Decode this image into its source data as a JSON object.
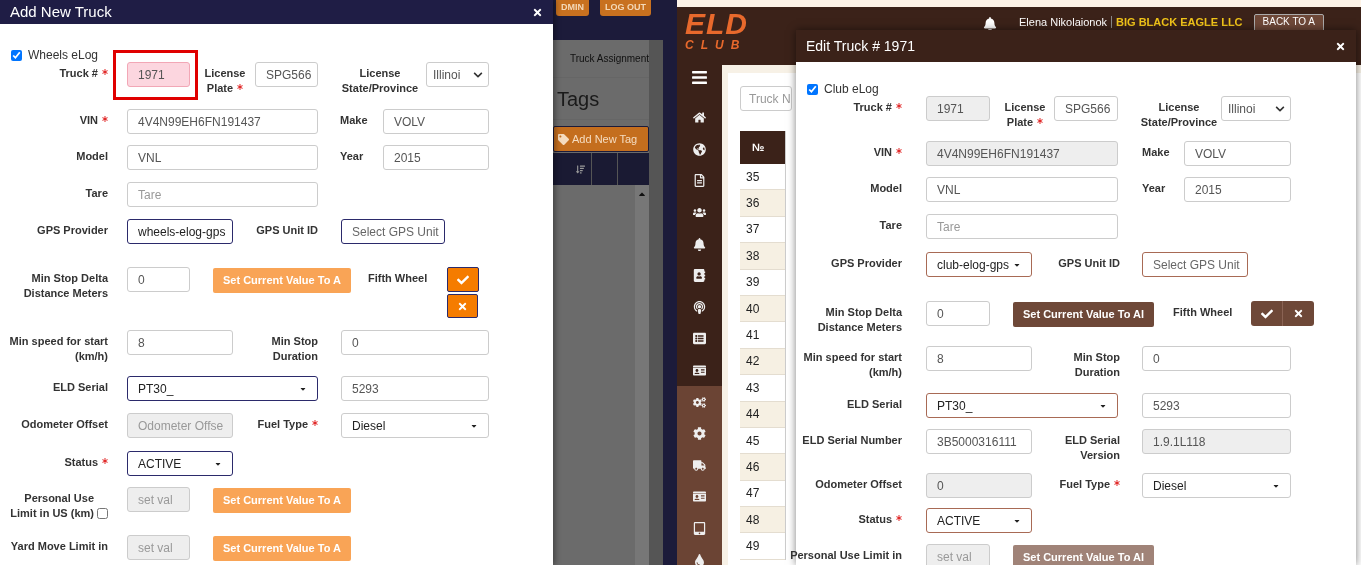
{
  "wheels_screen": {
    "topbar_buttons": [
      "DMIN",
      "LOG OUT"
    ],
    "tab": "Truck Assignment",
    "heading": "Tags",
    "add_button": "Add New Tag",
    "modal": {
      "kind": "wheels",
      "title": "Add New Truck",
      "checkbox": {
        "label": "Wheels eLog",
        "checked": true
      },
      "rows": [
        {
          "fields": [
            {
              "kind": "label",
              "text": "Truck #",
              "required": true
            },
            {
              "kind": "input",
              "value": "1971",
              "highlighted": true
            },
            {
              "kind": "label",
              "text": "License Plate",
              "required": true
            },
            {
              "kind": "input",
              "value": "SPG566"
            },
            {
              "kind": "label",
              "text": "License State/Province"
            },
            {
              "kind": "native-select",
              "value": "Illinoi"
            }
          ]
        },
        {
          "fields": [
            {
              "kind": "label",
              "text": "VIN",
              "required": true
            },
            {
              "kind": "input",
              "value": "4V4N99EH6FN191437"
            },
            {
              "kind": "label",
              "text": "Make"
            },
            {
              "kind": "input",
              "value": "VOLV"
            }
          ]
        },
        {
          "fields": [
            {
              "kind": "label",
              "text": "Model"
            },
            {
              "kind": "input",
              "value": "VNL"
            },
            {
              "kind": "label",
              "text": "Year"
            },
            {
              "kind": "input",
              "value": "2015"
            }
          ]
        },
        {
          "fields": [
            {
              "kind": "label",
              "text": "Tare"
            },
            {
              "kind": "input",
              "placeholder": "Tare"
            }
          ]
        },
        {
          "fields": [
            {
              "kind": "label",
              "text": "GPS Provider"
            },
            {
              "kind": "select",
              "value": "wheels-elog-gps",
              "accent": true
            },
            {
              "kind": "label",
              "text": "GPS Unit ID"
            },
            {
              "kind": "select",
              "placeholder": "Select GPS Unit",
              "accent": true
            }
          ]
        },
        {
          "fields": [
            {
              "kind": "label",
              "text": "Min Stop Delta Distance Meters"
            },
            {
              "kind": "input",
              "value": "0"
            },
            {
              "kind": "button",
              "text": "Set Current Value To A"
            },
            {
              "kind": "label",
              "text": "Fifth Wheel"
            },
            {
              "kind": "toggle-stacked"
            }
          ]
        },
        {
          "fields": [
            {
              "kind": "label",
              "text": "Min speed for start (km/h)"
            },
            {
              "kind": "input",
              "value": "8"
            },
            {
              "kind": "label",
              "text": "Min Stop Duration"
            },
            {
              "kind": "input",
              "value": "0"
            }
          ]
        },
        {
          "fields": [
            {
              "kind": "label",
              "text": "ELD Serial"
            },
            {
              "kind": "select",
              "value": "PT30_",
              "accent": true
            },
            {
              "kind": "input",
              "value": "5293"
            }
          ]
        },
        {
          "fields": [
            {
              "kind": "label",
              "text": "Odometer Offset"
            },
            {
              "kind": "input",
              "placeholder": "Odometer Offse",
              "disabled": true
            },
            {
              "kind": "label",
              "text": "Fuel Type",
              "required": true
            },
            {
              "kind": "select",
              "value": "Diesel",
              "accent": false
            }
          ]
        },
        {
          "fields": [
            {
              "kind": "label",
              "text": "Status",
              "required": true
            },
            {
              "kind": "select",
              "value": "ACTIVE",
              "accent": true
            }
          ]
        },
        {
          "fields": [
            {
              "kind": "label",
              "text": "Personal Use Limit in US (km)",
              "checkbox": false
            },
            {
              "kind": "input",
              "placeholder": "set val",
              "disabled": true
            },
            {
              "kind": "button",
              "text": "Set Current Value To A"
            }
          ]
        },
        {
          "fields": [
            {
              "kind": "label",
              "text": "Yard Move Limit in"
            },
            {
              "kind": "input",
              "placeholder": "set val",
              "disabled": true
            },
            {
              "kind": "button",
              "text": "Set Current Value To A"
            }
          ]
        }
      ]
    }
  },
  "club_screen": {
    "logo": {
      "title": "ELD",
      "subtitle": "CLUB"
    },
    "user": "Elena Nikolaionok",
    "company": "BIG BLACK EAGLE LLC",
    "back_button": "BACK TO A",
    "search_placeholder": "Truck N",
    "table": {
      "columns": [
        "№"
      ],
      "rows": [
        "35",
        "36",
        "37",
        "38",
        "39",
        "40",
        "41",
        "42",
        "43",
        "44",
        "45",
        "46",
        "47",
        "48",
        "49"
      ]
    },
    "modal": {
      "kind": "club",
      "title": "Edit Truck # 1971",
      "checkbox": {
        "label": "Club eLog",
        "checked": true
      },
      "rows": [
        {
          "fields": [
            {
              "kind": "label",
              "text": "Truck #",
              "required": true
            },
            {
              "kind": "input",
              "value": "1971",
              "disabled": true
            },
            {
              "kind": "label",
              "text": "License Plate",
              "required": true
            },
            {
              "kind": "input",
              "value": "SPG566"
            },
            {
              "kind": "label",
              "text": "License State/Province"
            },
            {
              "kind": "native-select",
              "value": "Illinoi"
            }
          ]
        },
        {
          "fields": [
            {
              "kind": "label",
              "text": "VIN",
              "required": true
            },
            {
              "kind": "input",
              "value": "4V4N99EH6FN191437",
              "disabled": true
            },
            {
              "kind": "label",
              "text": "Make"
            },
            {
              "kind": "input",
              "value": "VOLV"
            }
          ]
        },
        {
          "fields": [
            {
              "kind": "label",
              "text": "Model"
            },
            {
              "kind": "input",
              "value": "VNL"
            },
            {
              "kind": "label",
              "text": "Year"
            },
            {
              "kind": "input",
              "value": "2015"
            }
          ]
        },
        {
          "fields": [
            {
              "kind": "label",
              "text": "Tare"
            },
            {
              "kind": "input",
              "placeholder": "Tare"
            }
          ]
        },
        {
          "fields": [
            {
              "kind": "label",
              "text": "GPS Provider"
            },
            {
              "kind": "select",
              "value": "club-elog-gps",
              "accent": true
            },
            {
              "kind": "label",
              "text": "GPS Unit ID"
            },
            {
              "kind": "select",
              "placeholder": "Select GPS Unit",
              "accent": true
            }
          ]
        },
        {
          "fields": [
            {
              "kind": "label",
              "text": "Min Stop Delta Distance Meters"
            },
            {
              "kind": "input",
              "value": "0"
            },
            {
              "kind": "button",
              "text": "Set Current Value To Al"
            },
            {
              "kind": "label",
              "text": "Fifth Wheel"
            },
            {
              "kind": "toggle-joined"
            }
          ]
        },
        {
          "fields": [
            {
              "kind": "label",
              "text": "Min speed for start (km/h)"
            },
            {
              "kind": "input",
              "value": "8"
            },
            {
              "kind": "label",
              "text": "Min Stop Duration"
            },
            {
              "kind": "input",
              "value": "0"
            }
          ]
        },
        {
          "fields": [
            {
              "kind": "label",
              "text": "ELD Serial"
            },
            {
              "kind": "select",
              "value": "PT30_",
              "accent": true
            },
            {
              "kind": "input",
              "value": "5293"
            }
          ]
        },
        {
          "fields": [
            {
              "kind": "label",
              "text": "ELD Serial Number"
            },
            {
              "kind": "input",
              "value": "3B5000316111"
            },
            {
              "kind": "label",
              "text": "ELD Serial Version"
            },
            {
              "kind": "input",
              "value": "1.9.1L118",
              "disabled": true
            }
          ]
        },
        {
          "fields": [
            {
              "kind": "label",
              "text": "Odometer Offset"
            },
            {
              "kind": "input",
              "value": "0",
              "disabled": true
            },
            {
              "kind": "label",
              "text": "Fuel Type",
              "required": true
            },
            {
              "kind": "select",
              "value": "Diesel",
              "accent": false
            }
          ]
        },
        {
          "fields": [
            {
              "kind": "label",
              "text": "Status",
              "required": true
            },
            {
              "kind": "select",
              "value": "ACTIVE",
              "accent": true
            }
          ]
        },
        {
          "fields": [
            {
              "kind": "label",
              "text": "Personal Use Limit in"
            },
            {
              "kind": "input",
              "placeholder": "set val",
              "disabled": true
            },
            {
              "kind": "button",
              "text": "Set Current Value To Al",
              "disabled": true
            }
          ]
        }
      ]
    }
  }
}
